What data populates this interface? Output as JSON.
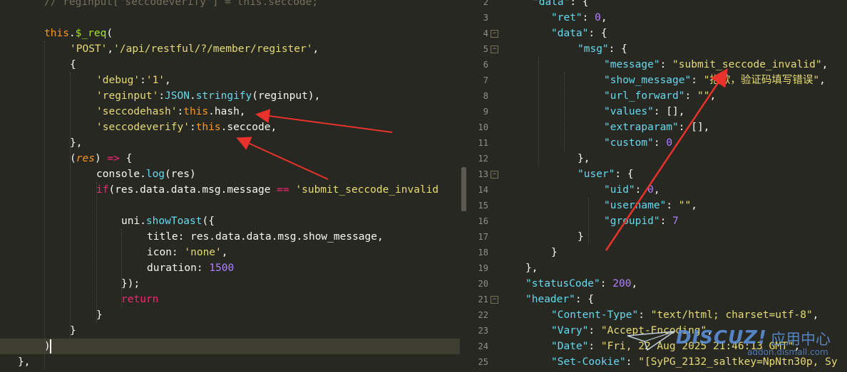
{
  "left_editor": {
    "lines": [
      [
        [
          "c-com",
          "// reginput['seccodeverify'] = this.seccode;"
        ]
      ],
      [],
      [
        [
          "c-this",
          "this"
        ],
        [
          "",
          "."
        ],
        [
          "c-fn",
          "$_req"
        ],
        [
          "",
          "("
        ]
      ],
      [
        [
          "c-str",
          "'POST'"
        ],
        [
          "",
          ","
        ],
        [
          "c-str",
          "'/api/restful/?/member/register'"
        ],
        [
          "",
          ","
        ]
      ],
      [
        [
          "",
          "{"
        ]
      ],
      [
        [
          "c-str",
          "'debug'"
        ],
        [
          "",
          ":"
        ],
        [
          "c-str",
          "'1'"
        ],
        [
          "",
          ","
        ]
      ],
      [
        [
          "c-str",
          "'reginput'"
        ],
        [
          "",
          ":"
        ],
        [
          "c-bi",
          "JSON"
        ],
        [
          "",
          "."
        ],
        [
          "c-bi",
          "stringify"
        ],
        [
          "",
          "(reginput),"
        ]
      ],
      [
        [
          "c-str",
          "'seccodehash'"
        ],
        [
          "",
          ":"
        ],
        [
          "c-this",
          "this"
        ],
        [
          "",
          ".hash,"
        ]
      ],
      [
        [
          "c-str",
          "'seccodeverify'"
        ],
        [
          "",
          ":"
        ],
        [
          "c-this",
          "this"
        ],
        [
          "",
          ".seccode,"
        ]
      ],
      [
        [
          "",
          "},"
        ]
      ],
      [
        [
          "",
          "("
        ],
        [
          "c-arg",
          "res"
        ],
        [
          "",
          ") "
        ],
        [
          "c-kw",
          "=>"
        ],
        [
          "",
          " {"
        ]
      ],
      [
        [
          "",
          "console."
        ],
        [
          "c-bi",
          "log"
        ],
        [
          "",
          "(res)"
        ]
      ],
      [
        [
          "c-kw",
          "if"
        ],
        [
          "",
          "(res.data.data.msg.message "
        ],
        [
          "c-kw",
          "=="
        ],
        [
          "",
          " "
        ],
        [
          "c-str",
          "'submit_seccode_invalid"
        ]
      ],
      [],
      [
        [
          "",
          "uni."
        ],
        [
          "c-bi",
          "showToast"
        ],
        [
          "",
          "({"
        ]
      ],
      [
        [
          "",
          "title: res.data.data.msg.show_message,"
        ]
      ],
      [
        [
          "",
          "icon: "
        ],
        [
          "c-str",
          "'none'"
        ],
        [
          "",
          ","
        ]
      ],
      [
        [
          "",
          "duration: "
        ],
        [
          "c-num",
          "1500"
        ]
      ],
      [
        [
          "",
          "});"
        ]
      ],
      [
        [
          "c-kw",
          "return"
        ]
      ],
      [
        [
          "",
          "}"
        ]
      ],
      [
        [
          "",
          "}"
        ]
      ],
      [
        [
          "",
          ")"
        ]
      ],
      [
        [
          "",
          "},"
        ]
      ],
      [
        [
          "",
          ""
        ]
      ]
    ],
    "indents": [
      62,
      0,
      62,
      98,
      98,
      135,
      135,
      135,
      135,
      98,
      98,
      135,
      135,
      0,
      170,
      206,
      206,
      206,
      170,
      170,
      135,
      98,
      62,
      25,
      0
    ]
  },
  "right_editor": {
    "line_numbers": [
      "2",
      "3",
      "4",
      "5",
      "6",
      "7",
      "8",
      "9",
      "10",
      "11",
      "12",
      "13",
      "14",
      "15",
      "16",
      "17",
      "18",
      "19",
      "20",
      "21",
      "22",
      "23",
      "24",
      "25"
    ],
    "lines": [
      [
        [
          "c-key",
          "\"data\""
        ],
        [
          "",
          ": {"
        ]
      ],
      [
        [
          "c-key",
          "\"ret\""
        ],
        [
          "",
          ": "
        ],
        [
          "c-num",
          "0"
        ],
        [
          "",
          ","
        ]
      ],
      [
        [
          "c-key",
          "\"data\""
        ],
        [
          "",
          ": {"
        ]
      ],
      [
        [
          "c-key",
          "\"msg\""
        ],
        [
          "",
          ": {"
        ]
      ],
      [
        [
          "c-key",
          "\"message\""
        ],
        [
          "",
          ": "
        ],
        [
          "c-str",
          "\"submit_seccode_invalid\""
        ],
        [
          "",
          ","
        ]
      ],
      [
        [
          "c-key",
          "\"show_message\""
        ],
        [
          "",
          ": "
        ],
        [
          "c-str",
          "\"抱歉，验证码填写错误\""
        ],
        [
          "",
          ","
        ]
      ],
      [
        [
          "c-key",
          "\"url_forward\""
        ],
        [
          "",
          ": "
        ],
        [
          "c-str",
          "\"\""
        ],
        [
          "",
          ","
        ]
      ],
      [
        [
          "c-key",
          "\"values\""
        ],
        [
          "",
          ": [],"
        ]
      ],
      [
        [
          "c-key",
          "\"extraparam\""
        ],
        [
          "",
          ": [],"
        ]
      ],
      [
        [
          "c-key",
          "\"custom\""
        ],
        [
          "",
          ": "
        ],
        [
          "c-num",
          "0"
        ]
      ],
      [
        [
          "",
          "},"
        ]
      ],
      [
        [
          "c-key",
          "\"user\""
        ],
        [
          "",
          ": {"
        ]
      ],
      [
        [
          "c-key",
          "\"uid\""
        ],
        [
          "",
          ": "
        ],
        [
          "c-num",
          "0"
        ],
        [
          "",
          ","
        ]
      ],
      [
        [
          "c-key",
          "\"username\""
        ],
        [
          "",
          ": "
        ],
        [
          "c-str",
          "\"\""
        ],
        [
          "",
          ","
        ]
      ],
      [
        [
          "c-key",
          "\"groupid\""
        ],
        [
          "",
          ": "
        ],
        [
          "c-num",
          "7"
        ]
      ],
      [
        [
          "",
          "}"
        ]
      ],
      [
        [
          "",
          "}"
        ]
      ],
      [
        [
          "",
          "},"
        ]
      ],
      [
        [
          "c-key",
          "\"statusCode\""
        ],
        [
          "",
          ": "
        ],
        [
          "c-num",
          "200"
        ],
        [
          "",
          ","
        ]
      ],
      [
        [
          "c-key",
          "\"header\""
        ],
        [
          "",
          ": {"
        ]
      ],
      [
        [
          "c-key",
          "\"Content-Type\""
        ],
        [
          "",
          ": "
        ],
        [
          "c-str",
          "\"text/html; charset=utf-8\""
        ],
        [
          "",
          ","
        ]
      ],
      [
        [
          "c-key",
          "\"Vary\""
        ],
        [
          "",
          ": "
        ],
        [
          "c-str",
          "\"Accept-Encoding\""
        ],
        [
          "",
          ","
        ]
      ],
      [
        [
          "c-key",
          "\"Date\""
        ],
        [
          "",
          ": "
        ],
        [
          "c-str",
          "\"Fri, 22 Aug 2025 21:46:13 GMT\""
        ],
        [
          "",
          ","
        ]
      ],
      [
        [
          "c-key",
          "\"Set-Cookie\""
        ],
        [
          "",
          ": "
        ],
        [
          "c-str",
          "\"[SyPG_2132_saltkey=NpNtn30p, Sy"
        ]
      ]
    ],
    "indents": [
      92,
      118,
      118,
      155,
      192,
      192,
      192,
      192,
      192,
      192,
      155,
      155,
      192,
      192,
      192,
      155,
      118,
      82,
      82,
      82,
      118,
      118,
      118,
      118
    ],
    "folds": [
      "4",
      "5",
      "13",
      "21"
    ]
  },
  "watermark": {
    "logo": "DISCUZ!",
    "cn": "应用中心",
    "url": "addon.dismall.com"
  },
  "annotation_color": "#e8322b"
}
